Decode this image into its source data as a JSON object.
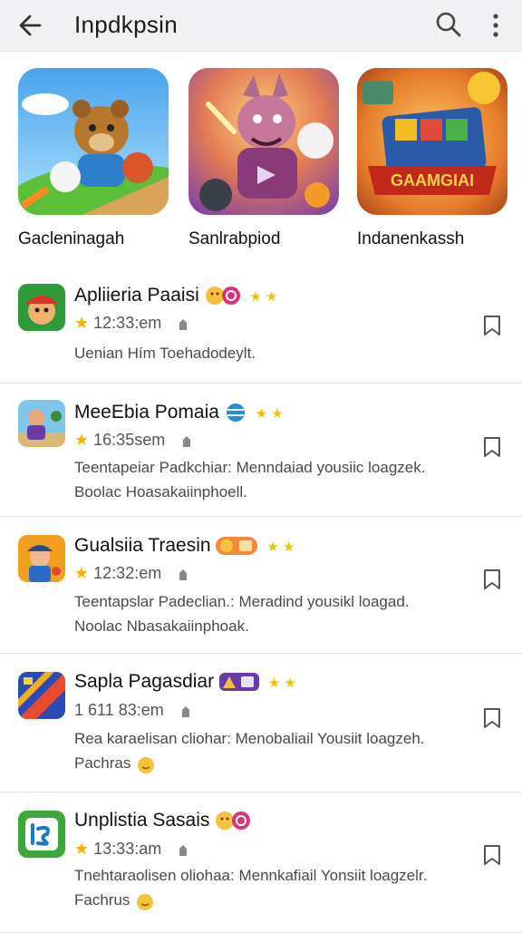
{
  "app_bar": {
    "title": "Inpdkpsin",
    "back_icon": "arrow-left-icon",
    "search_icon": "search-icon",
    "more_icon": "more-vertical-icon"
  },
  "featured": [
    {
      "label": "Gacleninagah",
      "art": "bear-runner-game-art"
    },
    {
      "label": "Sanlrabpiod",
      "art": "fox-fighter-game-art"
    },
    {
      "label": "Indanenkassh",
      "art": "board-game-art",
      "art_text": "GAAMGIAI"
    }
  ],
  "apps": [
    {
      "name": "Apliieria Paaisi",
      "time": "12:33:em",
      "desc": [
        "Uenian Hím Toehadodeylt."
      ],
      "stars": "★ ★"
    },
    {
      "name": "MeeEbia Pomaia",
      "time": "16:35sem",
      "desc": [
        "Teentapeiar Padkchiar: Menndaiad yousiic loagzek.",
        "Boolac Hoasakaiinphoell."
      ],
      "stars": "★ ★"
    },
    {
      "name": "Gualsiia Traesin",
      "time": "12:32:em",
      "desc": [
        "Teentapslar Padeclian.: Meradind yousikl loagad.",
        "Noolac Nbasakaiinphoak."
      ],
      "stars": "★ ★"
    },
    {
      "name": "Sapla Pagasdiar",
      "time": "1 611 83:em",
      "desc": [
        "Rea karaelisan cliohar: Menobaliail Yousiit loagzeh.",
        "Pachras"
      ],
      "stars": "★ ★"
    },
    {
      "name": "Unplistia Sasais",
      "time": "13:33:am",
      "desc": [
        "Tnehtaraolisen oliohaa: Mennkafiail Yonsiit loagzelr.",
        "Fachrus"
      ],
      "stars": ""
    }
  ]
}
